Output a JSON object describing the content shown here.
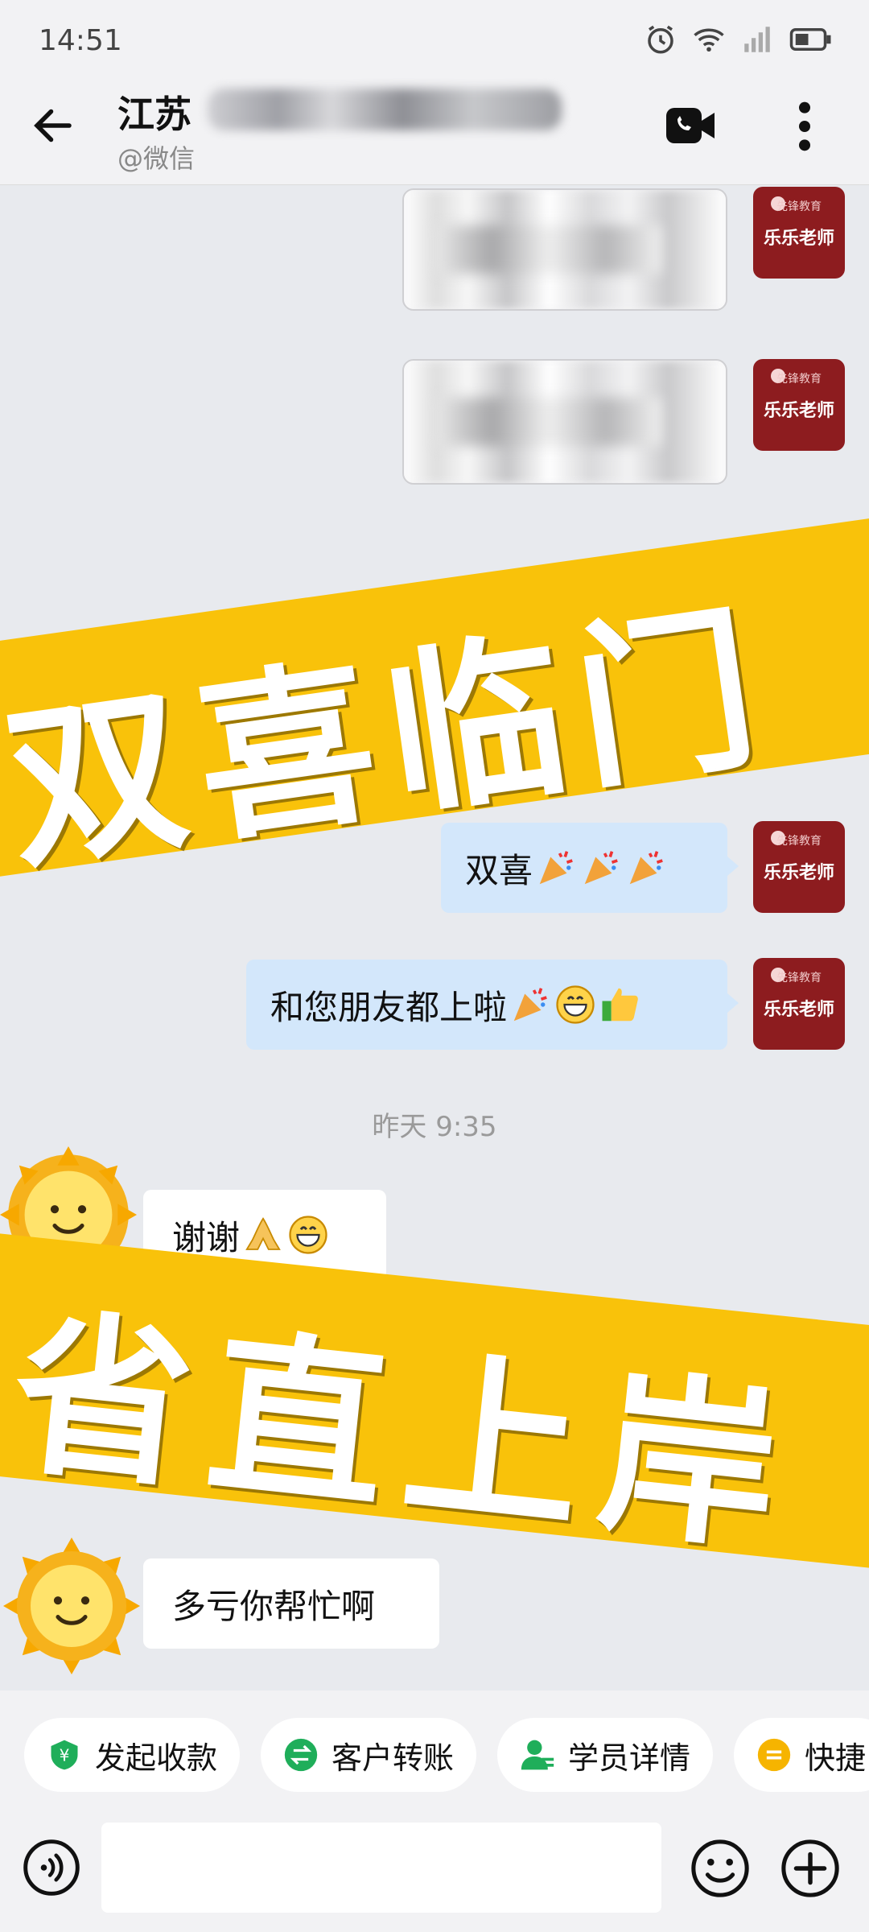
{
  "status_bar": {
    "time": "14:51",
    "icons": [
      "alarm-icon",
      "wifi-icon",
      "signal-icon",
      "battery-icon"
    ]
  },
  "header": {
    "title": "江苏",
    "subtitle": "@微信",
    "back_icon": "back-arrow-icon",
    "video_icon": "video-call-icon",
    "more_icon": "more-vertical-icon"
  },
  "avatar": {
    "brand": "先锋教育",
    "name": "乐乐老师",
    "color": "#8d1c1f"
  },
  "messages": [
    {
      "side": "right",
      "type": "image",
      "note": "blurred"
    },
    {
      "side": "right",
      "type": "image",
      "note": "blurred"
    },
    {
      "side": "right",
      "type": "text",
      "text": "双喜",
      "emojis": [
        "party-popper",
        "party-popper",
        "party-popper"
      ]
    },
    {
      "side": "right",
      "type": "text",
      "text": "和您朋友都上啦",
      "emojis": [
        "party-popper",
        "grin",
        "thumbs-up"
      ]
    },
    {
      "side": "left",
      "type": "text",
      "text": "谢谢",
      "emojis": [
        "pray",
        "grin"
      ]
    },
    {
      "side": "left",
      "type": "text",
      "text": "多亏你帮忙啊",
      "emojis": []
    }
  ],
  "timestamp": "昨天  9:35",
  "banners": {
    "top": "双喜临门",
    "bottom": "省直上岸",
    "color": "#f9c20a"
  },
  "quick_actions": [
    {
      "label": "发起收款",
      "icon": "payment-icon",
      "color": "#1fae5a"
    },
    {
      "label": "客户转账",
      "icon": "transfer-icon",
      "color": "#1fae5a"
    },
    {
      "label": "学员详情",
      "icon": "student-icon",
      "color": "#1fae5a"
    },
    {
      "label": "快捷",
      "icon": "quick-reply-icon",
      "color": "#f6b400"
    }
  ],
  "input_bar": {
    "placeholder": "",
    "voice_icon": "voice-icon",
    "emoji_icon": "emoji-icon",
    "plus_icon": "plus-icon"
  }
}
